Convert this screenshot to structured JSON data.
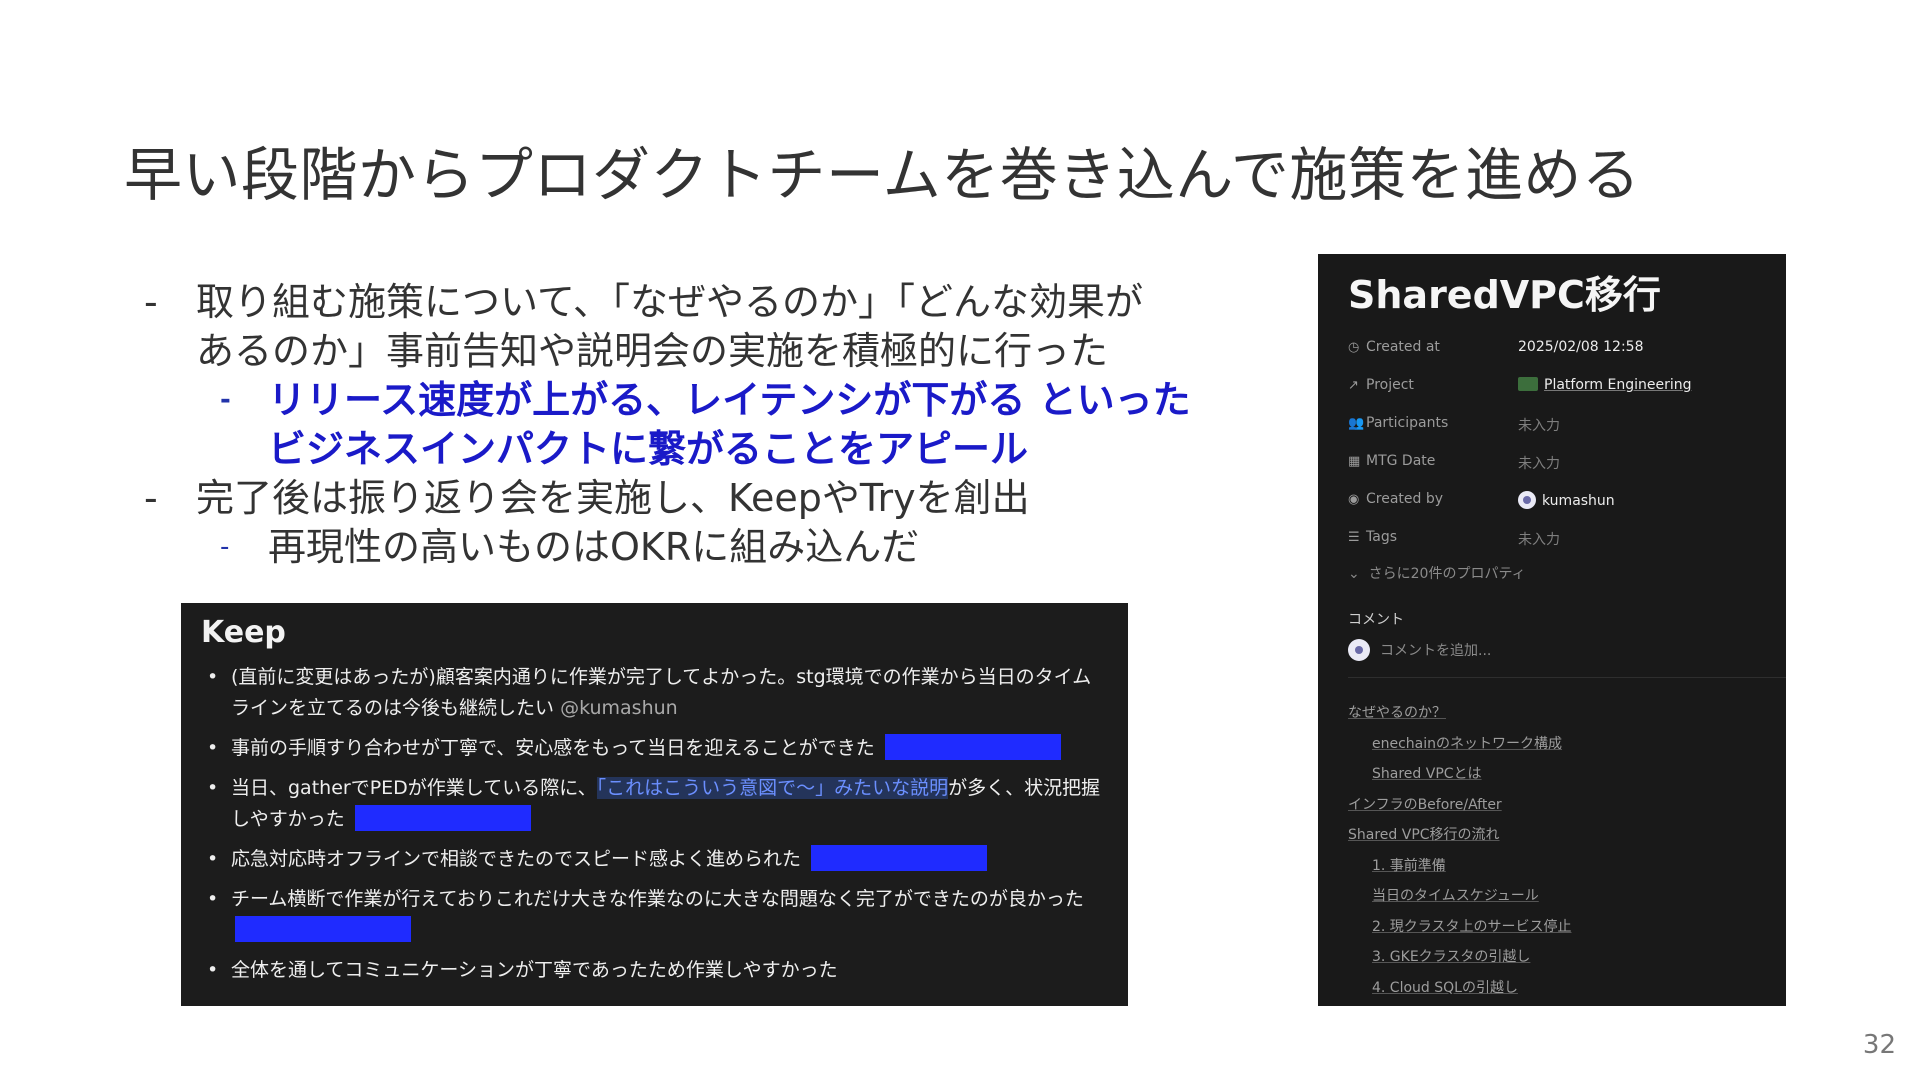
{
  "slide": {
    "title": "早い段階からプロダクトチームを巻き込んで施策を進める",
    "page_number": "32",
    "bullets": [
      {
        "level": 1,
        "text": "取り組む施策について、「なぜやるのか」「どんな効果が",
        "dash": "-"
      },
      {
        "level": 1,
        "text": "あるのか」事前告知や説明会の実施を積極的に行った",
        "dash": ""
      },
      {
        "level": 2,
        "text": "リリース速度が上がる、レイテンシが下がる といった",
        "dash": "-",
        "emphasis": true
      },
      {
        "level": 2,
        "text": "ビジネスインパクトに繋がることをアピール",
        "dash": "",
        "emphasis": true
      },
      {
        "level": 1,
        "text": "完了後は振り返り会を実施し、KeepやTryを創出",
        "dash": "-"
      },
      {
        "level": 2,
        "text": "再現性の高いものはOKRに組み込んだ",
        "dash": "-"
      }
    ]
  },
  "keep_panel": {
    "heading": "Keep",
    "items": [
      {
        "text": "(直前に変更はあったが)顧客案内通りに作業が完了してよかった。stg環境での作業から当日のタイムラインを立てるのは今後も継続したい",
        "mention": "@kumashun"
      },
      {
        "text": "事前の手順すり合わせが丁寧で、安心感をもって当日を迎えることができた"
      },
      {
        "text_before": "当日、gatherでPEDが作業している際に、",
        "link": "「これはこういう意図で〜」みたいな説明",
        "text_after": "が多く、状況把握しやすかった"
      },
      {
        "text": "応急対応時オフラインで相談できたのでスピード感よく進められた"
      },
      {
        "text": "チーム横断で作業が行えておりこれだけ大きな作業なのに大きな問題なく完了ができたのが良かった"
      },
      {
        "text": "全体を通してコミュニケーションが丁寧であったため作業しやすかった"
      }
    ],
    "redaction_color": "#1f2bff"
  },
  "notion_panel": {
    "title": "SharedVPC移行",
    "properties": [
      {
        "icon": "clock-icon",
        "name": "Created at",
        "value": "2025/02/08 12:58"
      },
      {
        "icon": "arrow-up-right-icon",
        "name": "Project",
        "value": "Platform Engineering"
      },
      {
        "icon": "people-icon",
        "name": "Participants",
        "value": "未入力"
      },
      {
        "icon": "calendar-icon",
        "name": "MTG Date",
        "value": "未入力"
      },
      {
        "icon": "user-circle-icon",
        "name": "Created by",
        "value": "kumashun"
      },
      {
        "icon": "list-icon",
        "name": "Tags",
        "value": "未入力"
      }
    ],
    "more_properties": "さらに20件のプロパティ",
    "comment_label": "コメント",
    "comment_placeholder": "コメントを追加...",
    "toc": [
      {
        "level": 1,
        "text": "なぜやるのか？"
      },
      {
        "level": 2,
        "text": "enechainのネットワーク構成"
      },
      {
        "level": 2,
        "text": "Shared VPCとは"
      },
      {
        "level": 1,
        "text": "インフラのBefore/After"
      },
      {
        "level": 1,
        "text": "Shared VPC移行の流れ"
      },
      {
        "level": 2,
        "text": "1. 事前準備"
      },
      {
        "level": 2,
        "text": "当日のタイムスケジュール"
      },
      {
        "level": 2,
        "text": "2. 現クラスタ上のサービス停止"
      },
      {
        "level": 2,
        "text": "3. GKEクラスタの引越し"
      },
      {
        "level": 2,
        "text": "4. Cloud SQLの引越し"
      }
    ]
  }
}
